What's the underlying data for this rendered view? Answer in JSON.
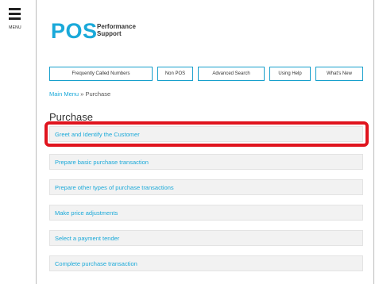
{
  "app": {
    "menu_label": "MENU",
    "logo_text": "POS",
    "logo_subtitle": "Performance Support"
  },
  "topnav": [
    {
      "label": "Frequently Called Numbers"
    },
    {
      "label": "Non POS"
    },
    {
      "label": "Advanced Search"
    },
    {
      "label": "Using Help"
    },
    {
      "label": "What's New"
    }
  ],
  "breadcrumb": {
    "link": "Main Menu",
    "separator": " » ",
    "current": "Purchase"
  },
  "page": {
    "title": "Purchase"
  },
  "items": [
    {
      "label": "Greet and Identify the Customer"
    },
    {
      "label": "Prepare basic purchase transaction"
    },
    {
      "label": "Prepare other types of purchase transactions"
    },
    {
      "label": "Make price adjustments"
    },
    {
      "label": "Select a payment tender"
    },
    {
      "label": "Complete purchase transaction"
    }
  ],
  "colors": {
    "accent": "#1aa9d9",
    "highlight": "#e0141e"
  }
}
